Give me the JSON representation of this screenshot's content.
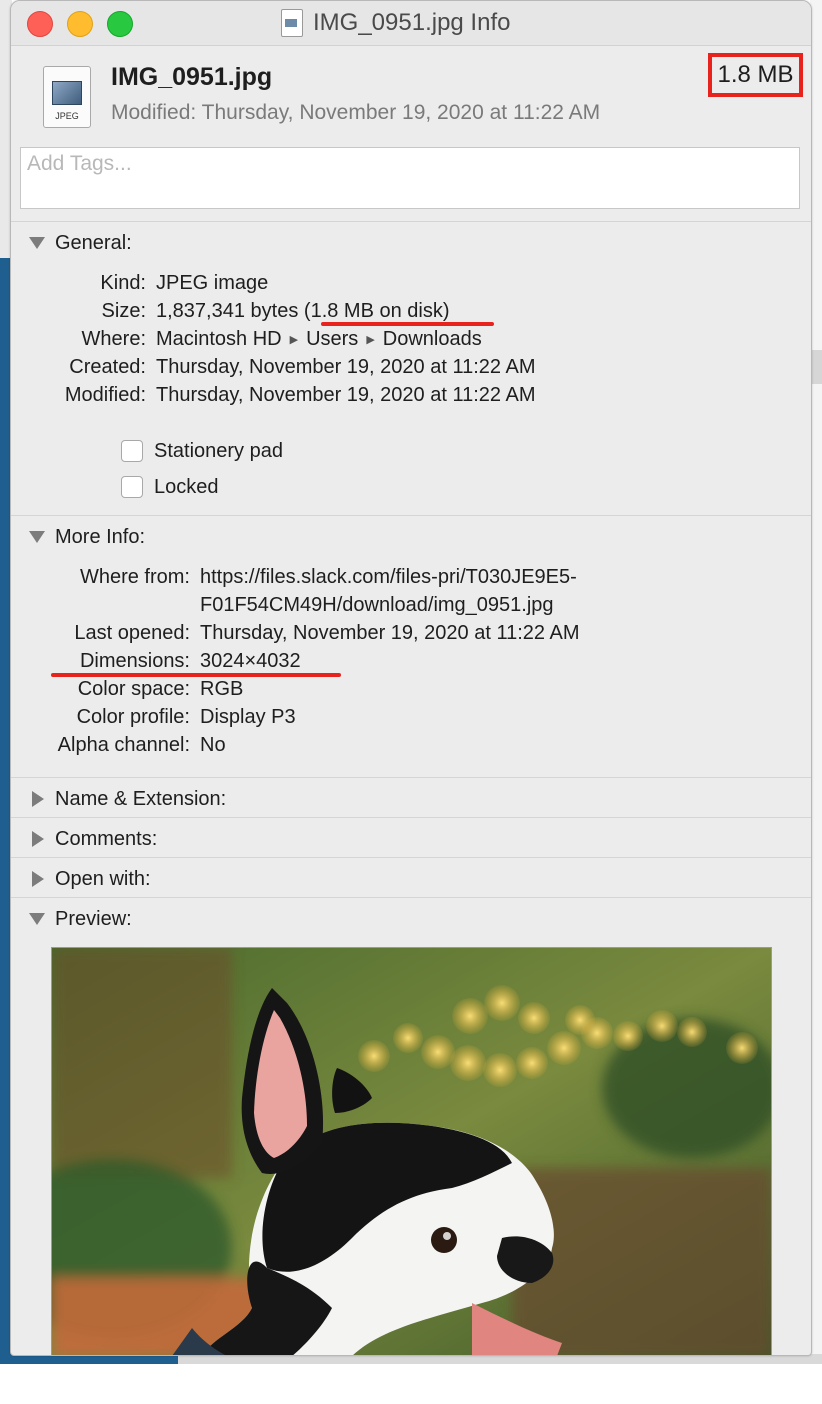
{
  "window": {
    "title": "IMG_0951.jpg Info"
  },
  "header": {
    "icon_label": "JPEG",
    "file_name": "IMG_0951.jpg",
    "modified": "Modified: Thursday, November 19, 2020 at 11:22 AM",
    "size": "1.8 MB"
  },
  "tags": {
    "placeholder": "Add Tags..."
  },
  "general": {
    "heading": "General:",
    "kind_label": "Kind:",
    "kind": "JPEG image",
    "size_label": "Size:",
    "size_bytes": "1,837,341 bytes",
    "size_disk": "(1.8 MB on disk)",
    "where_label": "Where:",
    "where_path": [
      "Macintosh HD",
      "Users",
      "Downloads"
    ],
    "created_label": "Created:",
    "created": "Thursday, November 19, 2020 at 11:22 AM",
    "modified_label": "Modified:",
    "modified": "Thursday, November 19, 2020 at 11:22 AM",
    "stationery_label": "Stationery pad",
    "stationery_checked": false,
    "locked_label": "Locked",
    "locked_checked": false
  },
  "more_info": {
    "heading": "More Info:",
    "where_from_label": "Where from:",
    "where_from_line1": "https://files.slack.com/files-pri/T030JE9E5-",
    "where_from_line2": "F01F54CM49H/download/img_0951.jpg",
    "last_opened_label": "Last opened:",
    "last_opened": "Thursday, November 19, 2020 at 11:22 AM",
    "dimensions_label": "Dimensions:",
    "dimensions": "3024×4032",
    "color_space_label": "Color space:",
    "color_space": "RGB",
    "color_profile_label": "Color profile:",
    "color_profile": "Display P3",
    "alpha_label": "Alpha channel:",
    "alpha": "No"
  },
  "collapsed_sections": {
    "name_extension": "Name & Extension:",
    "comments": "Comments:",
    "open_with": "Open with:"
  },
  "preview": {
    "heading": "Preview:"
  },
  "colors": {
    "annotation_red": "#e8231e",
    "close": "#fe5f57",
    "minimize": "#febc2e",
    "zoom": "#28c840"
  },
  "icons": [
    "jpeg-file-icon",
    "disclosure-triangle-icon",
    "path-arrow-icon",
    "checkbox"
  ]
}
